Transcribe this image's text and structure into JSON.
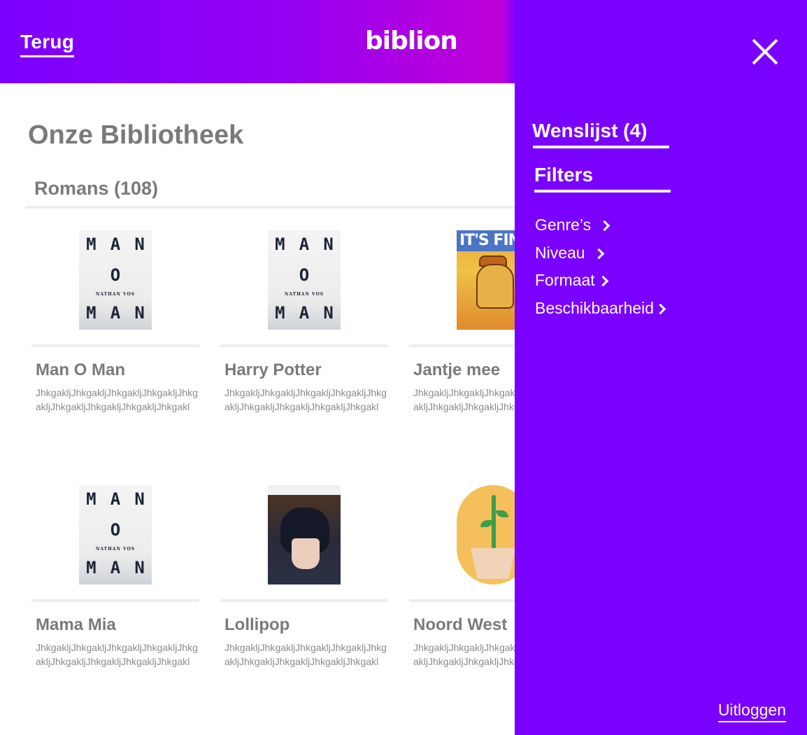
{
  "header": {
    "back_label": "Terug",
    "logo_text": "biblion"
  },
  "main": {
    "title": "Onze Bibliotheek",
    "section_title": "Romans (108)",
    "books": [
      {
        "title": "Man O Man",
        "desc": "JhkgakljJhkgakljJhkgakljJhkgakljJhkgakljJhkgakljJhkgakljJhkgakljJhkgakl",
        "cover": "man-o-man"
      },
      {
        "title": "Harry Potter",
        "desc": "JhkgakljJhkgakljJhkgakljJhkgakljJhkgakljJhkgakljJhkgakljJhkgakljJhkgakl",
        "cover": "man-o-man"
      },
      {
        "title": "Jantje mee",
        "desc": "JhkgakljJhkgakljJhkgakljJhkgakljJhkgakljJhkgakljJhkgakljJhkgakljJhkgakl",
        "cover": "meme"
      },
      {
        "title": "Mama Mia",
        "desc": "JhkgakljJhkgakljJhkgakljJhkgakljJhkgakljJhkgakljJhkgakljJhkgakljJhkgakl",
        "cover": "man-o-man"
      },
      {
        "title": "Lollipop",
        "desc": "JhkgakljJhkgakljJhkgakljJhkgakljJhkgakljJhkgakljJhkgakljJhkgakljJhkgakl",
        "cover": "anime"
      },
      {
        "title": "Noord West",
        "desc": "JhkgakljJhkgakljJhkgakljJhkgakljJhkgakljJhkgakljJhkgakljJhkgakljJhkgakl",
        "cover": "plant"
      }
    ],
    "cover_text": {
      "top": [
        "M",
        "A",
        "N"
      ],
      "middle": "O",
      "author": "NATHAN VOS",
      "bottom": [
        "M",
        "A",
        "N"
      ],
      "meme_banner": "IT'S FIN"
    }
  },
  "panel": {
    "wishlist_label": "Wenslijst (4)",
    "filters_label": "Filters",
    "filters": [
      "Genre’s",
      "Niveau",
      "Formaat",
      "Beschikbaarheid"
    ],
    "logout_label": "Uitloggen"
  },
  "colors": {
    "accent": "#7a00ff",
    "gradient_mid": "#c000d8"
  }
}
